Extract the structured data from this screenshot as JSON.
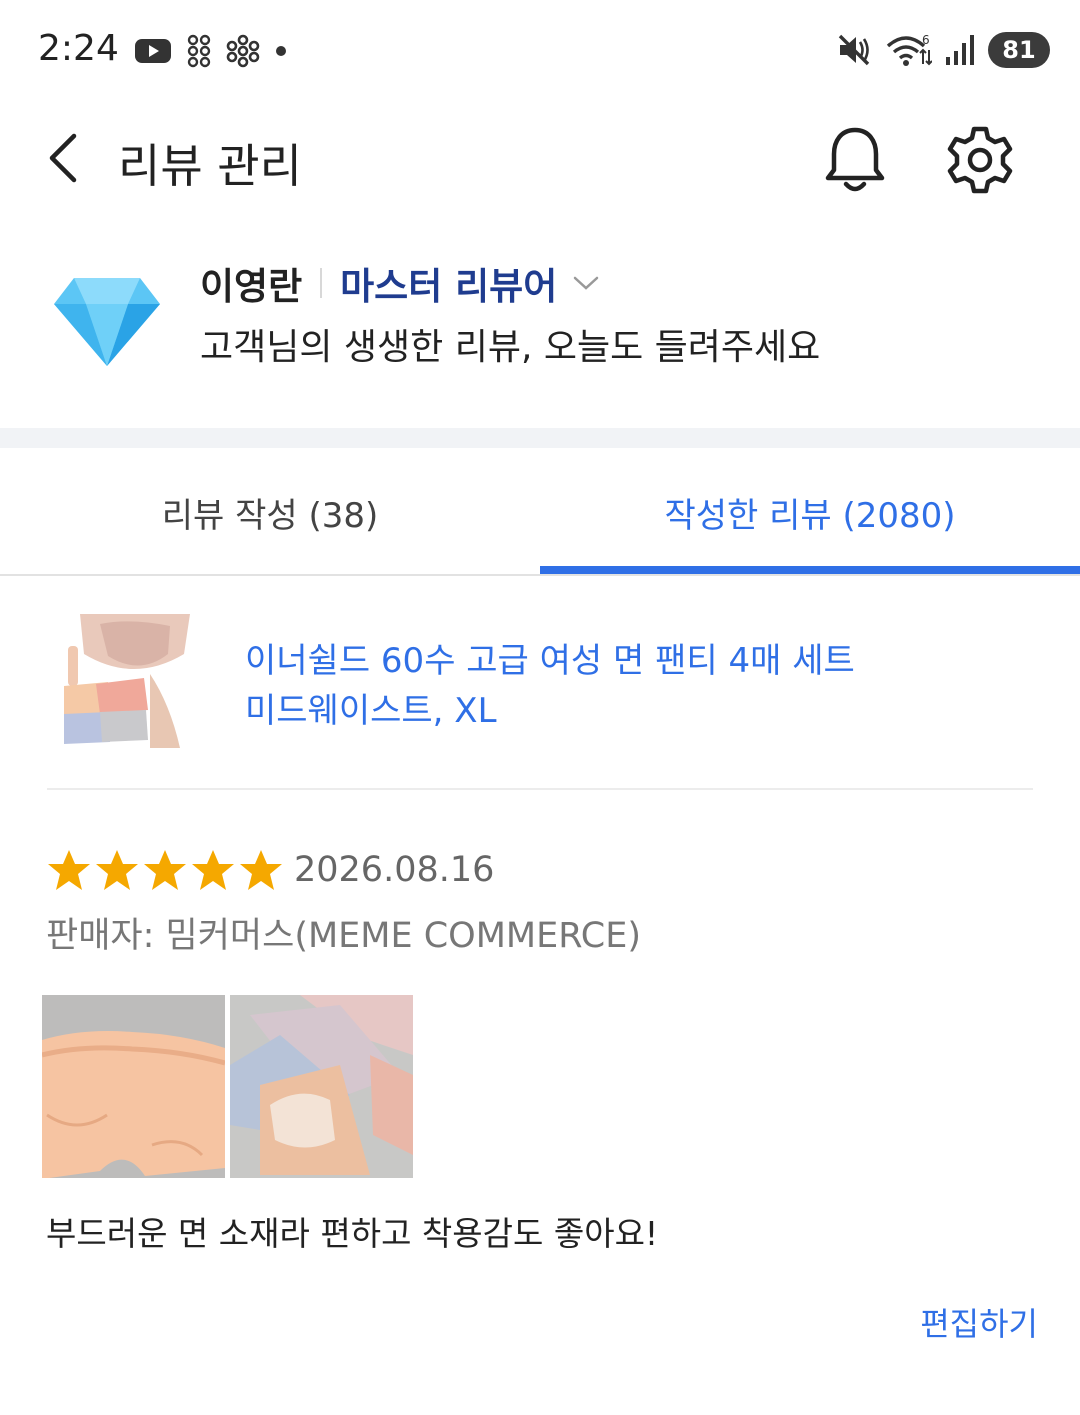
{
  "status_bar": {
    "time": "2:24",
    "battery": "81",
    "icons": [
      "youtube-icon",
      "app-grid-icon",
      "flower-icon",
      "dot-icon",
      "mute-icon",
      "wifi-icon",
      "signal-icon"
    ]
  },
  "header": {
    "title": "리뷰 관리",
    "icons": [
      "back-arrow-icon",
      "bell-icon",
      "gear-icon"
    ]
  },
  "profile": {
    "name": "이영란",
    "badge": "마스터 리뷰어",
    "message": "고객님의 생생한 리뷰, 오늘도 들려주세요",
    "badge_color": "#1f3c8f"
  },
  "tabs": {
    "write": "리뷰 작성 (38)",
    "written": "작성한 리뷰 (2080)",
    "active_color": "#2f6fe6"
  },
  "product": {
    "title": "이너쉴드 60수 고급 여성 면 팬티 4매 세트",
    "option": "미드웨이스트, XL"
  },
  "review": {
    "rating": 5,
    "date": "2026.08.16",
    "seller": "판매자: 밈커머스(MEME COMMERCE)",
    "text": "부드러운 면 소재라 편하고 착용감도 좋아요!",
    "edit_label": "편집하기",
    "star_color": "#f5a800"
  }
}
